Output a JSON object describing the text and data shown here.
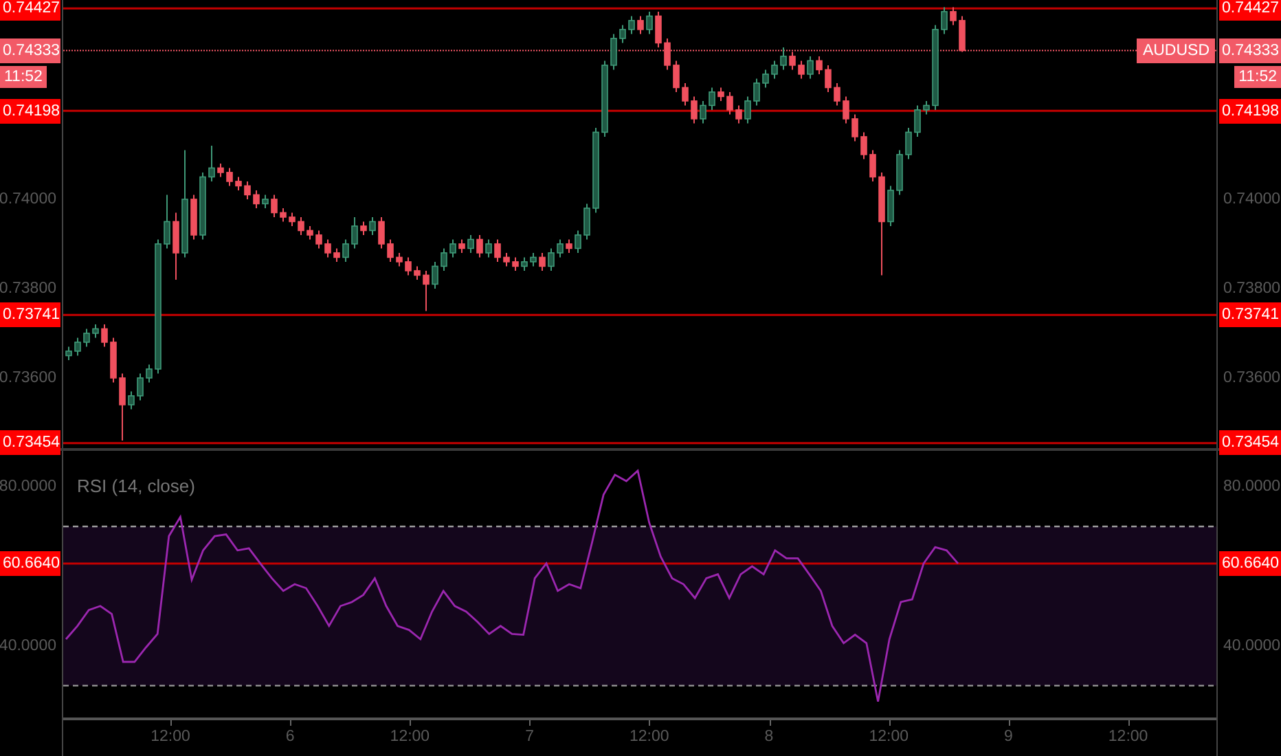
{
  "price_pane": {
    "chart_data": {
      "type": "candlestick",
      "ylim": [
        0.73443,
        0.74446
      ],
      "yticks": [
        {
          "value": 0.74,
          "label": "0.74000"
        },
        {
          "value": 0.738,
          "label": "0.73800"
        },
        {
          "value": 0.736,
          "label": "0.73600"
        }
      ],
      "categories": [
        null,
        null,
        null,
        null,
        null,
        null,
        null,
        null,
        null,
        null,
        null,
        null,
        null,
        null,
        null,
        null,
        null,
        null,
        null,
        null,
        null,
        null,
        null,
        null,
        null,
        null,
        null,
        null,
        null,
        null,
        null,
        null,
        null,
        null,
        null,
        null,
        null,
        null,
        null,
        null,
        null,
        null,
        null,
        null,
        null,
        null,
        null,
        null,
        null,
        null,
        null,
        null,
        null,
        null,
        null,
        null,
        null,
        null,
        null,
        null,
        null,
        null,
        null,
        null,
        null,
        null,
        null,
        null,
        null,
        null,
        null,
        null,
        null,
        null,
        null,
        null,
        null,
        null,
        null,
        null,
        null,
        null,
        null,
        null,
        null,
        null,
        null,
        null,
        null,
        null,
        null,
        null,
        null,
        null,
        null,
        null,
        null,
        null,
        null,
        null,
        null
      ],
      "series": [
        {
          "name": "AUDUSD",
          "ohlc": [
            [
              0.7365,
              0.7367,
              0.7364,
              0.7366
            ],
            [
              0.7366,
              0.7369,
              0.7365,
              0.7368
            ],
            [
              0.7368,
              0.7371,
              0.7367,
              0.737
            ],
            [
              0.737,
              0.7372,
              0.7369,
              0.7371
            ],
            [
              0.7371,
              0.7372,
              0.7367,
              0.7368
            ],
            [
              0.7368,
              0.7369,
              0.7359,
              0.736
            ],
            [
              0.736,
              0.7361,
              0.7346,
              0.7354
            ],
            [
              0.7354,
              0.7357,
              0.7353,
              0.7356
            ],
            [
              0.7356,
              0.7361,
              0.7355,
              0.736
            ],
            [
              0.736,
              0.7363,
              0.7359,
              0.7362
            ],
            [
              0.7362,
              0.7391,
              0.7361,
              0.739
            ],
            [
              0.739,
              0.7401,
              0.7389,
              0.7395
            ],
            [
              0.7395,
              0.7397,
              0.7382,
              0.7388
            ],
            [
              0.7388,
              0.7411,
              0.7387,
              0.74
            ],
            [
              0.74,
              0.7401,
              0.7391,
              0.7392
            ],
            [
              0.7392,
              0.7406,
              0.7391,
              0.7405
            ],
            [
              0.7405,
              0.7412,
              0.7404,
              0.7407
            ],
            [
              0.7407,
              0.7408,
              0.7405,
              0.7406
            ],
            [
              0.7406,
              0.7407,
              0.7403,
              0.7404
            ],
            [
              0.7404,
              0.7405,
              0.7402,
              0.7403
            ],
            [
              0.7403,
              0.7404,
              0.74,
              0.7401
            ],
            [
              0.7401,
              0.7402,
              0.7398,
              0.7399
            ],
            [
              0.7399,
              0.7401,
              0.7398,
              0.74
            ],
            [
              0.74,
              0.7401,
              0.7396,
              0.7397
            ],
            [
              0.7397,
              0.7398,
              0.7395,
              0.7396
            ],
            [
              0.7396,
              0.7397,
              0.7394,
              0.7395
            ],
            [
              0.7395,
              0.7396,
              0.7392,
              0.7393
            ],
            [
              0.7393,
              0.7394,
              0.7391,
              0.7392
            ],
            [
              0.7392,
              0.7393,
              0.7389,
              0.739
            ],
            [
              0.739,
              0.7391,
              0.7387,
              0.7388
            ],
            [
              0.7388,
              0.7389,
              0.7386,
              0.7387
            ],
            [
              0.7387,
              0.7391,
              0.7386,
              0.739
            ],
            [
              0.739,
              0.7396,
              0.7389,
              0.7394
            ],
            [
              0.7394,
              0.7395,
              0.7392,
              0.7393
            ],
            [
              0.7393,
              0.7396,
              0.7392,
              0.7395
            ],
            [
              0.7395,
              0.7396,
              0.7389,
              0.739
            ],
            [
              0.739,
              0.7391,
              0.7386,
              0.7387
            ],
            [
              0.7387,
              0.7388,
              0.7385,
              0.7386
            ],
            [
              0.7386,
              0.7387,
              0.7383,
              0.7384
            ],
            [
              0.7384,
              0.7385,
              0.7382,
              0.7383
            ],
            [
              0.7383,
              0.7384,
              0.7375,
              0.7381
            ],
            [
              0.7381,
              0.7386,
              0.738,
              0.7385
            ],
            [
              0.7385,
              0.7389,
              0.7384,
              0.7388
            ],
            [
              0.7388,
              0.7391,
              0.7387,
              0.739
            ],
            [
              0.739,
              0.7391,
              0.7388,
              0.7389
            ],
            [
              0.7389,
              0.7392,
              0.7388,
              0.7391
            ],
            [
              0.7391,
              0.7392,
              0.7387,
              0.7388
            ],
            [
              0.7388,
              0.7391,
              0.7387,
              0.739
            ],
            [
              0.739,
              0.7391,
              0.7386,
              0.7387
            ],
            [
              0.7387,
              0.7388,
              0.7385,
              0.7386
            ],
            [
              0.7386,
              0.7387,
              0.7384,
              0.7385
            ],
            [
              0.7385,
              0.7387,
              0.7384,
              0.7386
            ],
            [
              0.7386,
              0.7388,
              0.7385,
              0.7387
            ],
            [
              0.7387,
              0.7388,
              0.7384,
              0.7385
            ],
            [
              0.7385,
              0.7389,
              0.7384,
              0.7388
            ],
            [
              0.7388,
              0.7391,
              0.7387,
              0.739
            ],
            [
              0.739,
              0.7391,
              0.7388,
              0.7389
            ],
            [
              0.7389,
              0.7393,
              0.7388,
              0.7392
            ],
            [
              0.7392,
              0.7399,
              0.7391,
              0.7398
            ],
            [
              0.7398,
              0.7416,
              0.7397,
              0.7415
            ],
            [
              0.7415,
              0.7431,
              0.7414,
              0.743
            ],
            [
              0.743,
              0.7437,
              0.7429,
              0.7436
            ],
            [
              0.7436,
              0.7439,
              0.7435,
              0.7438
            ],
            [
              0.7438,
              0.7441,
              0.7437,
              0.744
            ],
            [
              0.744,
              0.7441,
              0.7437,
              0.7438
            ],
            [
              0.7438,
              0.7442,
              0.7437,
              0.7441
            ],
            [
              0.7441,
              0.7442,
              0.7434,
              0.7435
            ],
            [
              0.7435,
              0.7436,
              0.7429,
              0.743
            ],
            [
              0.743,
              0.7431,
              0.7424,
              0.7425
            ],
            [
              0.7425,
              0.7426,
              0.7421,
              0.7422
            ],
            [
              0.7422,
              0.7423,
              0.7417,
              0.7418
            ],
            [
              0.7418,
              0.7422,
              0.7417,
              0.7421
            ],
            [
              0.7421,
              0.7425,
              0.742,
              0.7424
            ],
            [
              0.7424,
              0.7425,
              0.7422,
              0.7423
            ],
            [
              0.7423,
              0.7424,
              0.7419,
              0.742
            ],
            [
              0.742,
              0.7421,
              0.7417,
              0.7418
            ],
            [
              0.7418,
              0.7423,
              0.7417,
              0.7422
            ],
            [
              0.7422,
              0.7427,
              0.7421,
              0.7426
            ],
            [
              0.7426,
              0.7429,
              0.7425,
              0.7428
            ],
            [
              0.7428,
              0.7431,
              0.7427,
              0.743
            ],
            [
              0.743,
              0.7434,
              0.7429,
              0.7432
            ],
            [
              0.7432,
              0.7433,
              0.7429,
              0.743
            ],
            [
              0.743,
              0.7431,
              0.7427,
              0.7428
            ],
            [
              0.7428,
              0.7432,
              0.7427,
              0.7431
            ],
            [
              0.7431,
              0.7432,
              0.7428,
              0.7429
            ],
            [
              0.7429,
              0.743,
              0.7424,
              0.7425
            ],
            [
              0.7425,
              0.7426,
              0.7421,
              0.7422
            ],
            [
              0.7422,
              0.7423,
              0.7417,
              0.7418
            ],
            [
              0.7418,
              0.7419,
              0.7413,
              0.7414
            ],
            [
              0.7414,
              0.7415,
              0.7409,
              0.741
            ],
            [
              0.741,
              0.7411,
              0.7404,
              0.7405
            ],
            [
              0.7405,
              0.7406,
              0.7383,
              0.7395
            ],
            [
              0.7395,
              0.7403,
              0.7394,
              0.7402
            ],
            [
              0.7402,
              0.7411,
              0.7401,
              0.741
            ],
            [
              0.741,
              0.7416,
              0.7409,
              0.7415
            ],
            [
              0.7415,
              0.7421,
              0.7414,
              0.742
            ],
            [
              0.742,
              0.7422,
              0.7419,
              0.7421
            ],
            [
              0.7421,
              0.7439,
              0.742,
              0.7438
            ],
            [
              0.7438,
              0.7443,
              0.7437,
              0.7442
            ],
            [
              0.7442,
              0.7443,
              0.7439,
              0.744
            ],
            [
              0.744,
              0.7441,
              0.7433,
              0.74333
            ]
          ]
        }
      ],
      "ref_lines": [
        {
          "axis": "y",
          "value": 0.74427,
          "label": "0.74427"
        },
        {
          "axis": "y",
          "value": 0.74333,
          "label": "0.74333"
        },
        {
          "axis": "y",
          "value": 0.74198,
          "label": "0.74198"
        },
        {
          "axis": "y",
          "value": 0.73741,
          "label": "0.73741"
        },
        {
          "axis": "y",
          "value": 0.73454,
          "label": "0.73454"
        }
      ]
    },
    "left_tick_labels": [
      "0.74000",
      "0.73800",
      "0.73600"
    ],
    "left_ref_labels": [
      "0.74427",
      "0.74333",
      "0.74198",
      "0.73741",
      "0.73454"
    ],
    "countdown_left": "11:52",
    "countdown_right": "11:52"
  },
  "rsi_pane": {
    "chart_data": {
      "type": "line",
      "ylim": [
        22,
        89
      ],
      "categories": [
        null,
        null,
        null,
        null,
        null,
        null,
        null,
        null,
        null,
        null,
        null,
        null,
        null,
        null,
        null,
        null,
        null,
        null,
        null,
        null,
        null,
        null,
        null,
        null,
        null,
        null,
        null,
        null,
        null,
        null,
        null,
        null,
        null,
        null,
        null,
        null,
        null,
        null,
        null,
        null,
        null,
        null,
        null,
        null,
        null,
        null,
        null,
        null,
        null,
        null,
        null,
        null,
        null,
        null,
        null,
        null,
        null,
        null,
        null,
        null,
        null,
        null,
        null,
        null,
        null,
        null,
        null,
        null,
        null,
        null,
        null,
        null,
        null,
        null,
        null,
        null,
        null,
        null,
        null
      ],
      "yticks": [
        {
          "value": 80,
          "label": "80.0000"
        },
        {
          "value": 40,
          "label": "40.0000"
        }
      ],
      "series": [
        {
          "name": "RSI (14, close)",
          "color": "#9c27b0",
          "values": [
            41.7,
            45,
            49,
            50,
            48,
            36,
            36,
            39.6,
            43,
            67.6,
            72.4,
            56.6,
            64,
            67.6,
            68,
            64,
            64.5,
            60.7,
            57,
            53.8,
            55.5,
            54.5,
            50,
            45,
            50,
            51,
            52.8,
            57,
            50,
            45,
            44,
            41.7,
            48.6,
            53.8,
            50,
            48.6,
            46,
            43,
            45,
            43,
            42.8,
            57,
            60.7,
            53.8,
            55.5,
            54.5,
            65.9,
            78,
            83,
            81.4,
            84,
            71,
            62.4,
            57,
            55.5,
            52,
            57,
            58,
            52,
            58,
            60,
            58,
            64,
            62,
            62,
            58,
            53.8,
            45,
            40.7,
            42.8,
            40.7,
            26,
            41.7,
            51,
            51.7,
            60.7,
            64.8,
            64,
            60.7
          ]
        }
      ],
      "ref_lines": [
        {
          "axis": "y",
          "value": 70
        },
        {
          "axis": "y",
          "value": 30
        },
        {
          "axis": "y",
          "value": 60.664,
          "label": "60.6640"
        }
      ]
    },
    "left_tick_labels": [
      "80.0000",
      "40.0000"
    ],
    "left_ref_labels": [
      "60.6640"
    ]
  },
  "time_axis": {
    "ticks": [
      "12:00",
      "6",
      "12:00",
      "7",
      "12:00",
      "8",
      "12:00",
      "9",
      "12:00"
    ]
  }
}
